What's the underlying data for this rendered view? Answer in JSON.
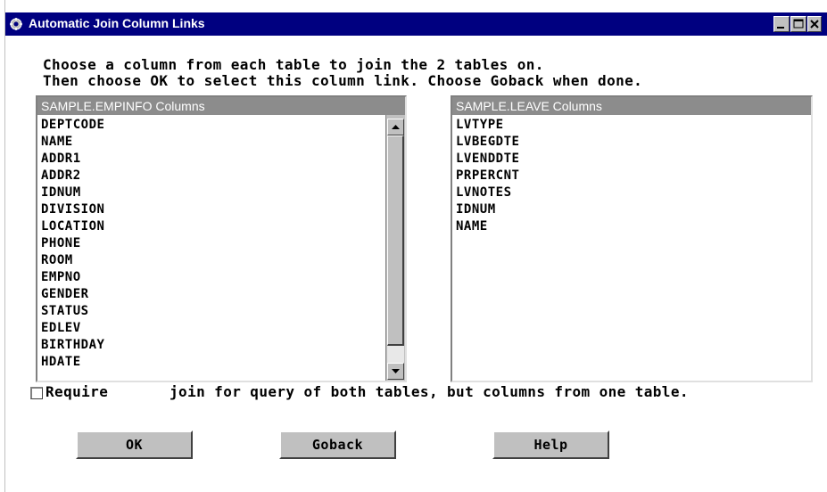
{
  "window": {
    "title": "Automatic Join Column Links"
  },
  "instructions": {
    "line1": "Choose a column from each table to join the 2 tables on.",
    "line2": "Then choose OK to select this column link. Choose Goback when done."
  },
  "left_list": {
    "header": "SAMPLE.EMPINFO Columns",
    "items": [
      "DEPTCODE",
      "NAME",
      "ADDR1",
      "ADDR2",
      "IDNUM",
      "DIVISION",
      "LOCATION",
      "PHONE",
      "ROOM",
      "EMPNO",
      "GENDER",
      "STATUS",
      "EDLEV",
      "BIRTHDAY",
      "HDATE"
    ]
  },
  "right_list": {
    "header": "SAMPLE.LEAVE Columns",
    "items": [
      "LVTYPE",
      "LVBEGDTE",
      "LVENDDTE",
      "PRPERCNT",
      "LVNOTES",
      "IDNUM",
      "NAME"
    ]
  },
  "require_option": {
    "label_part1": "Require",
    "label_part2": "join for query of both tables, but columns from one table."
  },
  "buttons": {
    "ok": "OK",
    "goback": "Goback",
    "help": "Help"
  }
}
